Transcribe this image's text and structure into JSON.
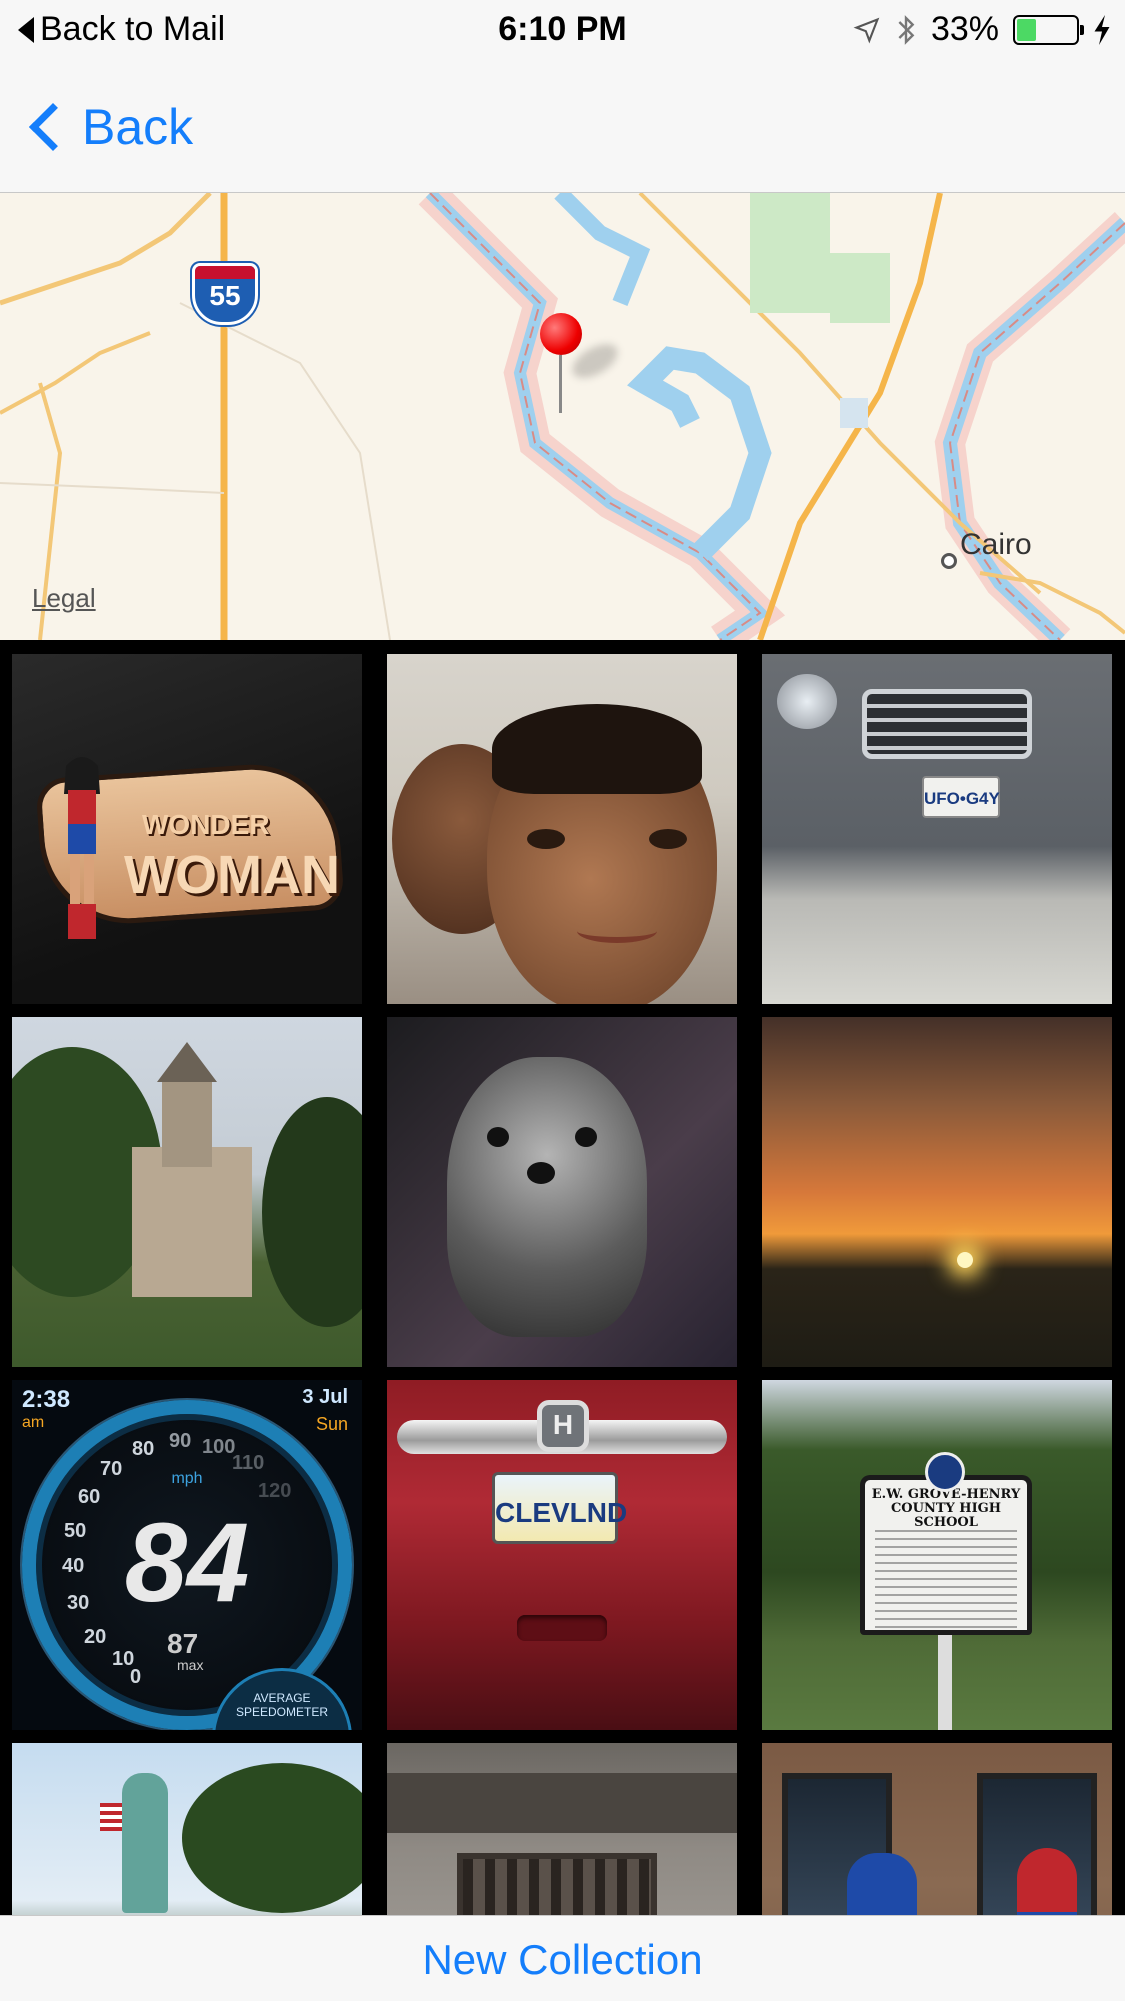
{
  "status_bar": {
    "back_app": "Back to Mail",
    "time": "6:10 PM",
    "battery": "33%",
    "battery_level": 0.33
  },
  "nav": {
    "back_label": "Back"
  },
  "map": {
    "legal_label": "Legal",
    "city_label": "Cairo",
    "interstate_number": "55"
  },
  "photos": {
    "wonder_woman": {
      "line1": "WONDER",
      "line2": "WOMAN"
    },
    "honda_plate": "UFO•G4Y",
    "ohio_plate": "CLEVLND",
    "speedometer": {
      "time": "2:38",
      "ampm": "am",
      "date": "3 Jul",
      "day": "Sun",
      "unit": "mph",
      "speed": "84",
      "max_value": "87",
      "max_label": "max",
      "avg_label": "AVERAGE SPEEDOMETER",
      "ticks": [
        "0",
        "10",
        "20",
        "30",
        "40",
        "50",
        "60",
        "70",
        "80",
        "90",
        "100",
        "110",
        "120"
      ]
    },
    "marker": {
      "heading": "E.W. GROVE-HENRY COUNTY HIGH SCHOOL"
    }
  },
  "bottom": {
    "new_collection_label": "New Collection"
  }
}
